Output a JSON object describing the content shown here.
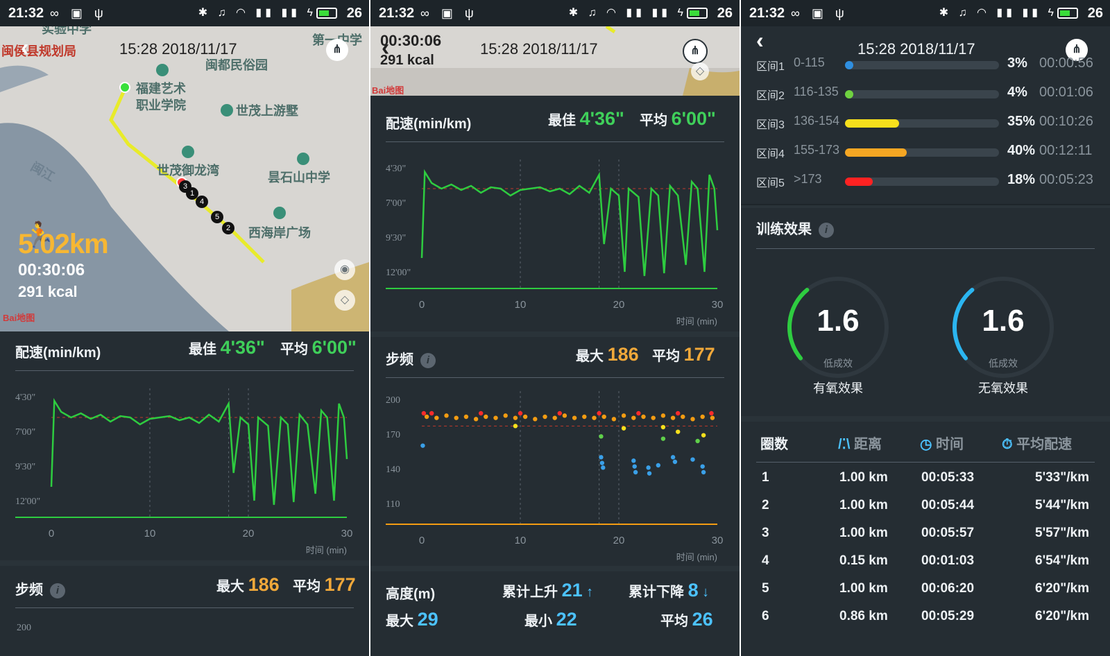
{
  "status": {
    "time": "21:32",
    "battery": "26"
  },
  "header": {
    "datetime": "15:28 2018/11/17"
  },
  "colors": {
    "pace_line": "#2ecc40",
    "cadence_red": "#ff2b2b",
    "cadence_orange": "#f39c12",
    "cadence_yellow": "#f7e01c",
    "cadence_green": "#5fd04a",
    "cadence_blue": "#3aa0e8",
    "accent_orange": "#f7b733",
    "gauge_green": "#2ecc40",
    "gauge_blue": "#2bb5f0"
  },
  "map": {
    "labels": [
      "实验中学",
      "闽侯县规划局",
      "闽都民俗园",
      "福建艺术",
      "职业学院",
      "世茂上游墅",
      "世茂御龙湾",
      "昙石山中学",
      "西海岸广场",
      "闽江",
      "第一中学"
    ],
    "markers": [
      "3",
      "1",
      "4",
      "5",
      "2"
    ],
    "baidu": "Bai地图"
  },
  "summary": {
    "distance": "5.02km",
    "duration": "00:30:06",
    "kcal": "291 kcal"
  },
  "pace": {
    "title": "配速(min/km)",
    "best_label": "最佳",
    "best_value": "4'36\"",
    "avg_label": "平均",
    "avg_value": "6'00\"",
    "yticks": [
      "4'30\"",
      "7'00\"",
      "9'30\"",
      "12'00\""
    ],
    "xticks": [
      "0",
      "10",
      "20",
      "30"
    ],
    "xunit": "时间 (min)"
  },
  "cadence": {
    "title": "步频",
    "max_label": "最大",
    "max_value": "186",
    "avg_label": "平均",
    "avg_value": "177",
    "yticks": [
      "200",
      "170",
      "140",
      "110"
    ],
    "xticks": [
      "0",
      "10",
      "20",
      "30"
    ],
    "xunit": "时间 (min)"
  },
  "altitude": {
    "title": "高度(m)",
    "up_label": "累计上升",
    "up_value": "21",
    "down_label": "累计下降",
    "down_value": "8",
    "max_label": "最大",
    "max_value": "29",
    "min_label": "最小",
    "min_value": "22",
    "avg_label": "平均",
    "avg_value": "26"
  },
  "hr_zones": [
    {
      "label": "区间1",
      "range": "0-115",
      "percent": "3%",
      "fraction": 0.03,
      "time": "00:00:56",
      "color": "#2f8fe0"
    },
    {
      "label": "区间2",
      "range": "116-135",
      "percent": "4%",
      "fraction": 0.04,
      "time": "00:01:06",
      "color": "#6fd140"
    },
    {
      "label": "区间3",
      "range": "136-154",
      "percent": "35%",
      "fraction": 0.35,
      "time": "00:10:26",
      "color": "#f7e01c"
    },
    {
      "label": "区间4",
      "range": "155-173",
      "percent": "40%",
      "fraction": 0.4,
      "time": "00:12:11",
      "color": "#f5a623"
    },
    {
      "label": "区间5",
      "range": ">173",
      "percent": "18%",
      "fraction": 0.18,
      "time": "00:05:23",
      "color": "#ff2222"
    }
  ],
  "training": {
    "title": "训练效果",
    "aerobic": {
      "value": "1.6",
      "level": "低成效",
      "label": "有氧效果"
    },
    "anaerobic": {
      "value": "1.6",
      "level": "低成效",
      "label": "无氧效果"
    }
  },
  "laps": {
    "headers": [
      "圈数",
      "距离",
      "时间",
      "平均配速"
    ],
    "rows": [
      {
        "n": "1",
        "dist": "1.00 km",
        "time": "00:05:33",
        "pace": "5'33\"/km"
      },
      {
        "n": "2",
        "dist": "1.00 km",
        "time": "00:05:44",
        "pace": "5'44\"/km"
      },
      {
        "n": "3",
        "dist": "1.00 km",
        "time": "00:05:57",
        "pace": "5'57\"/km"
      },
      {
        "n": "4",
        "dist": "0.15 km",
        "time": "00:01:03",
        "pace": "6'54\"/km"
      },
      {
        "n": "5",
        "dist": "1.00 km",
        "time": "00:06:20",
        "pace": "6'20\"/km"
      },
      {
        "n": "6",
        "dist": "0.86 km",
        "time": "00:05:29",
        "pace": "6'20\"/km"
      }
    ]
  },
  "chart_data": [
    {
      "type": "line",
      "title": "配速(min/km)",
      "xlabel": "时间 (min)",
      "ylabel": "",
      "xlim": [
        0,
        30
      ],
      "ylim_labels": [
        "4'30\"",
        "7'00\"",
        "9'30\"",
        "12'00\""
      ],
      "series": [
        {
          "values_min_per_km": [
            [
              0.0,
              11.0
            ],
            [
              0.3,
              4.8
            ],
            [
              1,
              5.6
            ],
            [
              2,
              6.0
            ],
            [
              3,
              5.7
            ],
            [
              4,
              6.1
            ],
            [
              5,
              5.8
            ],
            [
              6,
              6.3
            ],
            [
              7,
              5.9
            ],
            [
              8,
              6.0
            ],
            [
              9,
              6.5
            ],
            [
              10,
              6.1
            ],
            [
              11,
              6.0
            ],
            [
              12,
              5.9
            ],
            [
              13,
              6.2
            ],
            [
              14,
              6.0
            ],
            [
              15,
              6.4
            ],
            [
              16,
              5.8
            ],
            [
              17,
              6.3
            ],
            [
              18,
              5.0
            ],
            [
              18.5,
              10.0
            ],
            [
              19.2,
              6.0
            ],
            [
              20,
              6.5
            ],
            [
              20.6,
              12.0
            ],
            [
              21,
              6.0
            ],
            [
              22,
              6.6
            ],
            [
              22.6,
              12.3
            ],
            [
              23.3,
              6.0
            ],
            [
              24,
              6.5
            ],
            [
              24.6,
              12.1
            ],
            [
              25.2,
              5.8
            ],
            [
              26,
              6.5
            ],
            [
              26.8,
              11.5
            ],
            [
              27.4,
              5.5
            ],
            [
              28,
              6.0
            ],
            [
              28.7,
              12.0
            ],
            [
              29.2,
              5.0
            ],
            [
              29.7,
              6.0
            ],
            [
              30,
              9.0
            ]
          ]
        }
      ]
    },
    {
      "type": "scatter",
      "title": "步频",
      "xlabel": "时间 (min)",
      "ylim": [
        100,
        210
      ],
      "yticks": [
        200,
        170,
        140,
        110
      ],
      "series": [
        {
          "color": "orange",
          "points": [
            [
              0.5,
              185
            ],
            [
              1.5,
              184
            ],
            [
              2.5,
              186
            ],
            [
              3.5,
              184
            ],
            [
              4.5,
              185
            ],
            [
              5.5,
              183
            ],
            [
              6.5,
              185
            ],
            [
              7.5,
              184
            ],
            [
              8.5,
              186
            ],
            [
              9.5,
              184
            ],
            [
              10.5,
              185
            ],
            [
              11.5,
              183
            ],
            [
              12.5,
              185
            ],
            [
              13.5,
              184
            ],
            [
              14.5,
              186
            ],
            [
              15.5,
              184
            ],
            [
              16.5,
              185
            ],
            [
              17.5,
              184
            ],
            [
              18.5,
              185
            ],
            [
              19.5,
              183
            ],
            [
              20.5,
              186
            ],
            [
              21.5,
              184
            ],
            [
              22.5,
              185
            ],
            [
              23.5,
              184
            ],
            [
              24.5,
              186
            ],
            [
              25.5,
              184
            ],
            [
              26.5,
              185
            ],
            [
              27.5,
              183
            ],
            [
              28.5,
              185
            ],
            [
              29.5,
              184
            ]
          ]
        },
        {
          "color": "red",
          "points": [
            [
              0.2,
              188
            ],
            [
              1.0,
              188
            ],
            [
              6.0,
              188
            ],
            [
              10.0,
              188
            ],
            [
              14.0,
              188
            ],
            [
              18.0,
              188
            ],
            [
              22.0,
              188
            ],
            [
              26.0,
              188
            ],
            [
              29.4,
              188
            ]
          ]
        },
        {
          "color": "yellow",
          "points": [
            [
              9.5,
              177
            ],
            [
              20.5,
              175
            ],
            [
              24.5,
              176
            ],
            [
              26.0,
              172
            ],
            [
              28.6,
              169
            ]
          ]
        },
        {
          "color": "green",
          "points": [
            [
              18.2,
              168
            ],
            [
              24.5,
              166
            ],
            [
              28.0,
              164
            ]
          ]
        },
        {
          "color": "blue",
          "points": [
            [
              0.1,
              160
            ],
            [
              18.2,
              150
            ],
            [
              18.3,
              145
            ],
            [
              18.4,
              141
            ],
            [
              21.5,
              147
            ],
            [
              21.6,
              142
            ],
            [
              21.7,
              137
            ],
            [
              23.0,
              141
            ],
            [
              23.1,
              136
            ],
            [
              24.0,
              143
            ],
            [
              25.5,
              150
            ],
            [
              25.7,
              146
            ],
            [
              27.5,
              148
            ],
            [
              28.5,
              142
            ],
            [
              28.6,
              137
            ]
          ]
        }
      ]
    }
  ]
}
